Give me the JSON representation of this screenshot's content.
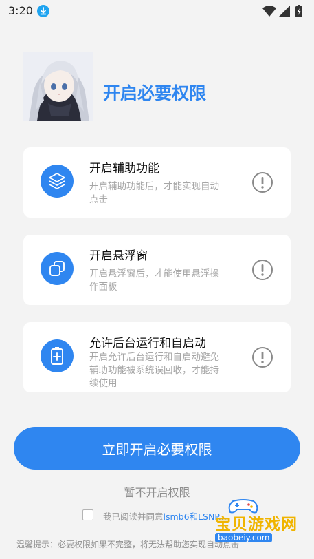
{
  "status_bar": {
    "time": "3:20",
    "icons": [
      "download-icon",
      "wifi-icon",
      "signal-icon",
      "battery-icon"
    ]
  },
  "header": {
    "title": "开启必要权限",
    "avatar": "anime-avatar"
  },
  "permissions": [
    {
      "title": "开启辅助功能",
      "desc_lines": [
        "开启辅助功能后，才能实现自动",
        "点击"
      ],
      "icon": "layers-icon"
    },
    {
      "title": "开启悬浮窗",
      "desc_lines": [
        "开启悬浮窗后，才能使用悬浮操",
        "作面板"
      ],
      "icon": "floating-window-icon"
    },
    {
      "title": "允许后台运行和自启动",
      "desc_lines": [
        "开启允许后台运行和自启动避免",
        "辅助功能被系统误回收，才能持",
        "续使用"
      ],
      "icon": "battery-plus-icon"
    }
  ],
  "actions": {
    "primary_label": "立即开启必要权限",
    "skip_label": "暂不开启权限"
  },
  "agreement": {
    "prefix": "我已阅读并同意",
    "link": "lsmb6和LSNP..."
  },
  "footer": {
    "hint": "温馨提示：必要权限如果不完整，将无法帮助您实现自动点击"
  },
  "watermark": {
    "text": "宝贝游戏网",
    "sub": "baobeiy.com"
  },
  "colors": {
    "accent": "#2f86f0",
    "background": "#f3f3f3",
    "card": "#ffffff",
    "muted": "#a6a6a6"
  }
}
